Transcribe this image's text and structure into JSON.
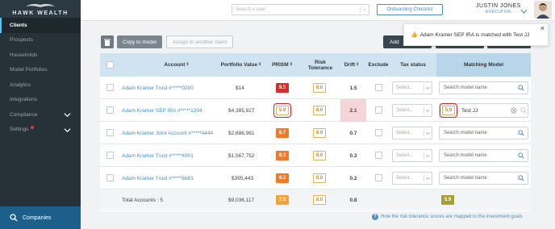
{
  "app": {
    "name": "HAWK WEALTH"
  },
  "sidebar": {
    "items": [
      {
        "label": "Clients",
        "active": true
      },
      {
        "label": "Prospects"
      },
      {
        "label": "Households"
      },
      {
        "label": "Model Portfolios"
      },
      {
        "label": "Analytics"
      },
      {
        "label": "Integrations"
      },
      {
        "label": "Compliance",
        "expandable": true
      },
      {
        "label": "Settings",
        "expandable": true,
        "alert": true
      }
    ],
    "footer": {
      "label": "Companies"
    }
  },
  "topbar": {
    "user_search_placeholder": "Search a user",
    "onboarding_label": "Onboarding Checklist",
    "user_name": "JUSTIN JONES",
    "user_role": "EXECUTIVE"
  },
  "toolbar": {
    "copy_label": "Copy to model",
    "assign_label": "Assign to another client",
    "dark_button_label": "Add"
  },
  "toast": {
    "message": "Adam Kramer SEP IRA is matched with Test JJ",
    "close": "×"
  },
  "table": {
    "headers": {
      "account": "Account",
      "portfolio_value": "Portfolio Value",
      "prism": "PRISM",
      "risk_tolerance": "Risk Tolerance",
      "drift": "Drift",
      "exclude": "Exclude",
      "tax_status": "Tax status",
      "matching_model": "Matching Model"
    },
    "tax_placeholder": "Select...",
    "model_placeholder": "Search model name",
    "rows": [
      {
        "account": "Adam Kramer Trust #*****0200",
        "value": "$14",
        "prism": "9.5",
        "prism_color": "#d32f2f",
        "risk": "8.0",
        "drift": "1.5"
      },
      {
        "account": "Adam Kramer SEP IRA #*****1204",
        "value": "$4,385,927",
        "prism": "5.9",
        "prism_color": "outline",
        "risk": "8.0",
        "drift": "2.1",
        "drift_highlight": true,
        "model_score": "5.9",
        "model_name": "Test JJ"
      },
      {
        "account": "Adam Kramer Joint Account #*****4444",
        "value": "$2,686,981",
        "prism": "8.7",
        "prism_color": "#ef7a2a",
        "risk": "8.0",
        "drift": "0.7"
      },
      {
        "account": "Adam Kramer Trust #*****4901",
        "value": "$1,567,752",
        "prism": "8.3",
        "prism_color": "#ef7a2a",
        "risk": "8.0",
        "drift": "0.3"
      },
      {
        "account": "Adam Kramer Trust #*****6681",
        "value": "$395,443",
        "prism": "8.2",
        "prism_color": "#ef7a2a",
        "risk": "8.0",
        "drift": "0.2"
      }
    ],
    "total": {
      "label": "Total Accounts : 5",
      "value": "$9,036,117",
      "prism": "7.2",
      "risk": "8.0",
      "drift": "0.8",
      "model_score": "5.9"
    }
  },
  "help_text": "How the risk tolerance scores are mapped to the investment goals",
  "colors": {
    "sidebar": "#263238",
    "accent": "#4a90c2",
    "prism_red": "#d32f2f",
    "prism_orange": "#ef7a2a",
    "total_prism": "#f2a33a",
    "model_score_olive": "#a3a036"
  }
}
